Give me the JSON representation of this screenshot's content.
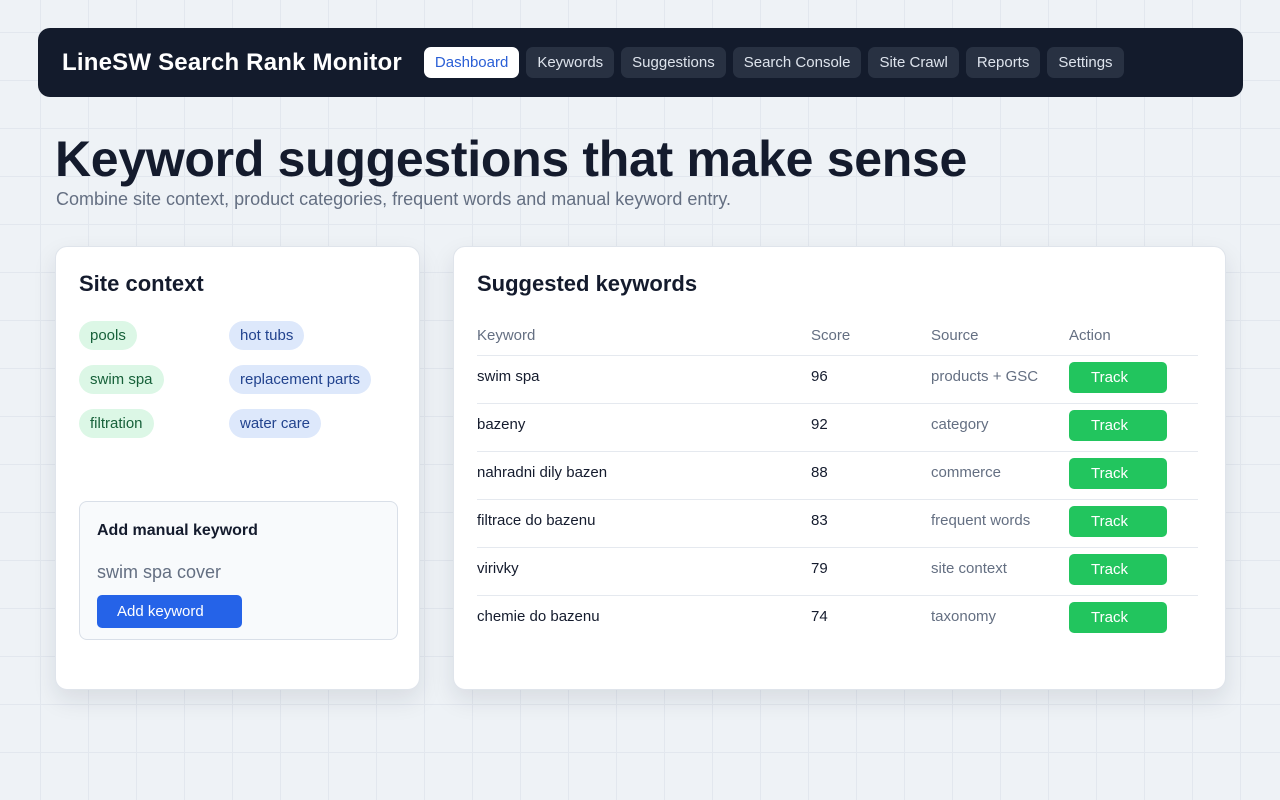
{
  "app": {
    "title": "LineSW Search Rank Monitor"
  },
  "nav": {
    "items": [
      {
        "label": "Dashboard",
        "active": true
      },
      {
        "label": "Keywords",
        "active": false
      },
      {
        "label": "Suggestions",
        "active": false
      },
      {
        "label": "Search Console",
        "active": false
      },
      {
        "label": "Site Crawl",
        "active": false
      },
      {
        "label": "Reports",
        "active": false
      },
      {
        "label": "Settings",
        "active": false
      }
    ]
  },
  "hero": {
    "title": "Keyword suggestions that make sense",
    "subtitle": "Combine site context, product categories, frequent words and manual keyword entry."
  },
  "site_context": {
    "title": "Site context",
    "chips": [
      {
        "label": "pools",
        "color": "green"
      },
      {
        "label": "hot tubs",
        "color": "blue"
      },
      {
        "label": "swim spa",
        "color": "green"
      },
      {
        "label": "replacement parts",
        "color": "blue"
      },
      {
        "label": "filtration",
        "color": "green"
      },
      {
        "label": "water care",
        "color": "blue"
      }
    ],
    "manual": {
      "title": "Add manual keyword",
      "input_value": "swim spa cover",
      "button_label": "Add keyword"
    }
  },
  "suggested": {
    "title": "Suggested keywords",
    "columns": [
      "Keyword",
      "Score",
      "Source",
      "Action"
    ],
    "rows": [
      {
        "keyword": "swim spa",
        "score": "96",
        "source": "products + GSC",
        "action": "Track"
      },
      {
        "keyword": "bazeny",
        "score": "92",
        "source": "category",
        "action": "Track"
      },
      {
        "keyword": "nahradni dily bazen",
        "score": "88",
        "source": "commerce",
        "action": "Track"
      },
      {
        "keyword": "filtrace do bazenu",
        "score": "83",
        "source": "frequent words",
        "action": "Track"
      },
      {
        "keyword": "virivky",
        "score": "79",
        "source": "site context",
        "action": "Track"
      },
      {
        "keyword": "chemie do bazenu",
        "score": "74",
        "source": "taxonomy",
        "action": "Track"
      }
    ]
  },
  "colors": {
    "accent": "#2563e8",
    "success": "#22c55e",
    "topbar": "#131b2c",
    "chip_green_bg": "#dcf7e6",
    "chip_blue_bg": "#dde8fb"
  }
}
